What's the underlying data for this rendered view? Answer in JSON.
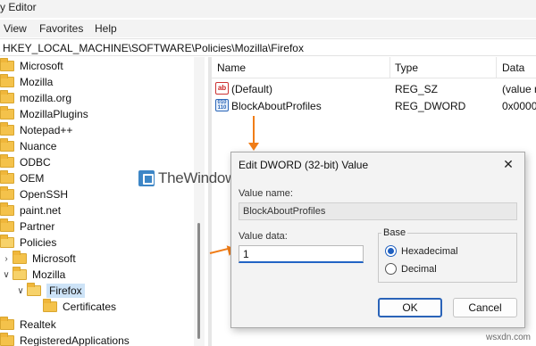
{
  "window": {
    "title": "y Editor"
  },
  "menu": [
    "View",
    "Favorites",
    "Help"
  ],
  "address": "HKEY_LOCAL_MACHINE\\SOFTWARE\\Policies\\Mozilla\\Firefox",
  "tree": {
    "items": [
      {
        "label": "Microsoft"
      },
      {
        "label": "Mozilla"
      },
      {
        "label": "mozilla.org"
      },
      {
        "label": "MozillaPlugins"
      },
      {
        "label": "Notepad++"
      },
      {
        "label": "Nuance"
      },
      {
        "label": "ODBC"
      },
      {
        "label": "OEM"
      },
      {
        "label": "OpenSSH"
      },
      {
        "label": "paint.net"
      },
      {
        "label": "Partner"
      },
      {
        "label": "Policies"
      },
      {
        "label": "Microsoft"
      },
      {
        "label": "Mozilla"
      },
      {
        "label": "Firefox"
      },
      {
        "label": "Certificates"
      },
      {
        "label": "Realtek"
      },
      {
        "label": "RegisteredApplications"
      }
    ]
  },
  "list": {
    "columns": [
      "Name",
      "Type",
      "Data"
    ],
    "rows": [
      {
        "name": "(Default)",
        "type": "REG_SZ",
        "data": "(value n",
        "icon": "string-value-icon"
      },
      {
        "name": "BlockAboutProfiles",
        "type": "REG_DWORD",
        "data": "0x00000",
        "icon": "binary-value-icon"
      }
    ]
  },
  "watermark": "TheWindowsClub",
  "dialog": {
    "title": "Edit DWORD (32-bit) Value",
    "close": "✕",
    "value_name_label": "Value name:",
    "value_name": "BlockAboutProfiles",
    "value_data_label": "Value data:",
    "value_data": "1",
    "base_label": "Base",
    "base_options": [
      {
        "label": "Hexadecimal",
        "checked": true
      },
      {
        "label": "Decimal",
        "checked": false
      }
    ],
    "ok": "OK",
    "cancel": "Cancel"
  },
  "site": "wsxdn.com",
  "colors": {
    "accent": "#2a63b8",
    "arrow": "#f07d18",
    "folder": "#f4c24b"
  }
}
